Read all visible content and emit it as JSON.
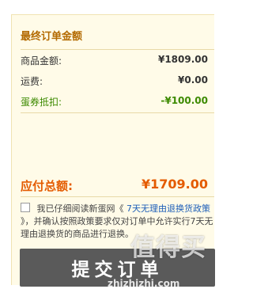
{
  "summary": {
    "title": "最终订单金额",
    "rows": [
      {
        "label": "商品金额:",
        "value": "¥1809.00"
      },
      {
        "label": "运费:",
        "value": "¥0.00"
      },
      {
        "label": "蛋券抵扣:",
        "value": "-¥100.00"
      }
    ],
    "total_label": "应付总额:",
    "total_value": "¥1709.00"
  },
  "agreement": {
    "prefix": "我已仔细阅读新蛋网《",
    "link": "7天无理由退换货政策",
    "suffix": "》，并确认按照政策要求仅对订单中允许实行7天无理由退换货的商品进行退换。"
  },
  "submit_label": "提交订单",
  "watermark": {
    "main": "值得买",
    "url": "zhizhizhi.com"
  },
  "colors": {
    "accent_orange": "#e45b00",
    "title_brown": "#b36a00",
    "discount_green": "#3c8a00",
    "link_blue": "#1e5fb8",
    "panel_bg": "#fffbe8"
  }
}
